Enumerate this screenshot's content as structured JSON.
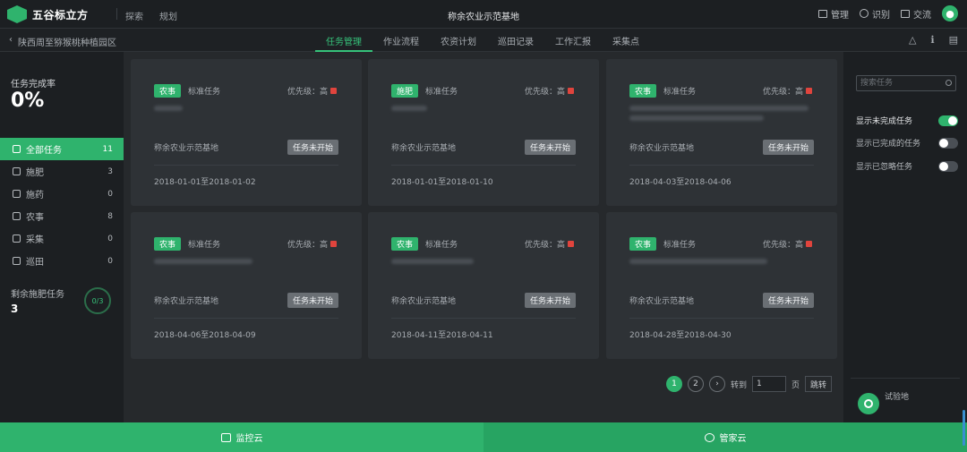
{
  "header": {
    "logo_text": "五谷标立方",
    "nav": [
      "探索",
      "规划"
    ],
    "title": "称余农业示范基地",
    "right": [
      {
        "label": "管理",
        "icon": "dashboard-icon"
      },
      {
        "label": "识别",
        "icon": "scan-icon"
      },
      {
        "label": "交流",
        "icon": "chat-icon"
      }
    ]
  },
  "subbar": {
    "back": "‹",
    "breadcrumb": "陕西周至猕猴桃种植园区",
    "tabs": [
      "任务管理",
      "作业流程",
      "农资计划",
      "巡田记录",
      "工作汇报",
      "采集点"
    ],
    "active_tab": "任务管理"
  },
  "sidebar": {
    "rate_label": "任务完成率",
    "rate_value": "0%",
    "items": [
      {
        "label": "全部任务",
        "count": "11",
        "icon": "all-tasks-icon"
      },
      {
        "label": "施肥",
        "count": "3",
        "icon": "fertilizer-icon"
      },
      {
        "label": "施药",
        "count": "0",
        "icon": "spray-icon"
      },
      {
        "label": "农事",
        "count": "8",
        "icon": "farming-icon"
      },
      {
        "label": "采集",
        "count": "0",
        "icon": "collect-icon"
      },
      {
        "label": "巡田",
        "count": "0",
        "icon": "patrol-icon"
      }
    ],
    "remain_label": "剩余施肥任务",
    "remain_value": "3",
    "ring_text": "0/3"
  },
  "tasks": [
    {
      "tag": "农事",
      "type": "标准任务",
      "priority_label": "优先级：高",
      "base": "称余农业示范基地",
      "status": "任务未开始",
      "date_range": "2018-01-01至2018-01-02"
    },
    {
      "tag": "施肥",
      "type": "标准任务",
      "priority_label": "优先级：高",
      "base": "称余农业示范基地",
      "status": "任务未开始",
      "date_range": "2018-01-01至2018-01-10"
    },
    {
      "tag": "农事",
      "type": "标准任务",
      "priority_label": "优先级：高",
      "base": "称余农业示范基地",
      "status": "任务未开始",
      "date_range": "2018-04-03至2018-04-06"
    },
    {
      "tag": "农事",
      "type": "标准任务",
      "priority_label": "优先级：高",
      "base": "称余农业示范基地",
      "status": "任务未开始",
      "date_range": "2018-04-06至2018-04-09"
    },
    {
      "tag": "农事",
      "type": "标准任务",
      "priority_label": "优先级：高",
      "base": "称余农业示范基地",
      "status": "任务未开始",
      "date_range": "2018-04-11至2018-04-11"
    },
    {
      "tag": "农事",
      "type": "标准任务",
      "priority_label": "优先级：高",
      "base": "称余农业示范基地",
      "status": "任务未开始",
      "date_range": "2018-04-28至2018-04-30"
    }
  ],
  "pagination": {
    "pages": [
      "1",
      "2"
    ],
    "next": "›",
    "goto_label": "转到",
    "goto_value": "1",
    "page_suffix": "页",
    "jump_label": "跳转"
  },
  "rightpanel": {
    "search_placeholder": "搜索任务",
    "toggles": [
      {
        "label": "显示未完成任务",
        "on": true
      },
      {
        "label": "显示已完成的任务",
        "on": false
      },
      {
        "label": "显示已忽略任务",
        "on": false
      }
    ],
    "demo_label": "试验地"
  },
  "bottombar": {
    "left": "监控云",
    "right": "管家云"
  },
  "colors": {
    "accent": "#2fb36d",
    "priority_high": "#e0443d"
  }
}
